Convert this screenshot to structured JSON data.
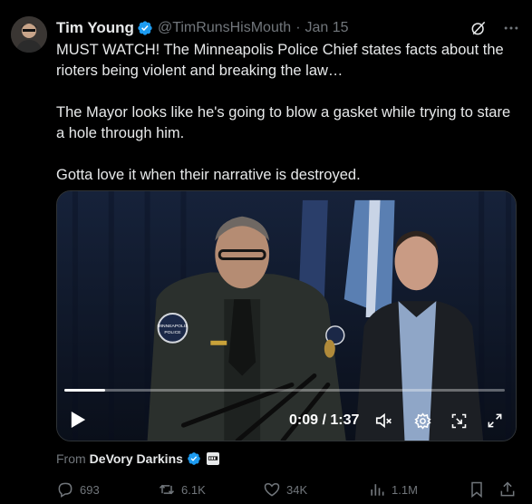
{
  "author": {
    "name": "Tim Young",
    "handle": "@TimRunsHisMouth",
    "separator": "·",
    "date": "Jan 15"
  },
  "tweet": {
    "paragraphs": [
      "MUST WATCH! The Minneapolis Police Chief states facts about the rioters being violent and breaking the law…",
      "The Mayor looks like he's going to blow a gasket while trying to stare a hole through him.",
      "Gotta love it when their narrative is destroyed."
    ]
  },
  "video": {
    "current_time": "0:09",
    "duration": "1:37",
    "time_display": "0:09 / 1:37",
    "progress_fraction": 0.093,
    "patch_lines": [
      "MINNEAPOLIS",
      "POLICE"
    ]
  },
  "source": {
    "label": "From",
    "name": "DeVory Darkins"
  },
  "stats": {
    "replies": "693",
    "reposts": "6.1K",
    "likes": "34K",
    "views": "1.1M"
  },
  "colors": {
    "background": "#000000",
    "text": "#e7e9ea",
    "muted": "#71767b",
    "verified": "#1d9bf0"
  },
  "icons": {
    "grok": "slash-circle-icon",
    "more": "more-horizontal-icon",
    "play": "play-icon",
    "mute": "volume-muted-icon",
    "settings": "gear-icon",
    "pip": "picture-in-picture-icon",
    "fullscreen": "expand-icon",
    "reply": "reply-icon",
    "repost": "repost-icon",
    "like": "heart-icon",
    "views": "views-icon",
    "bookmark": "bookmark-icon",
    "share": "share-icon"
  }
}
